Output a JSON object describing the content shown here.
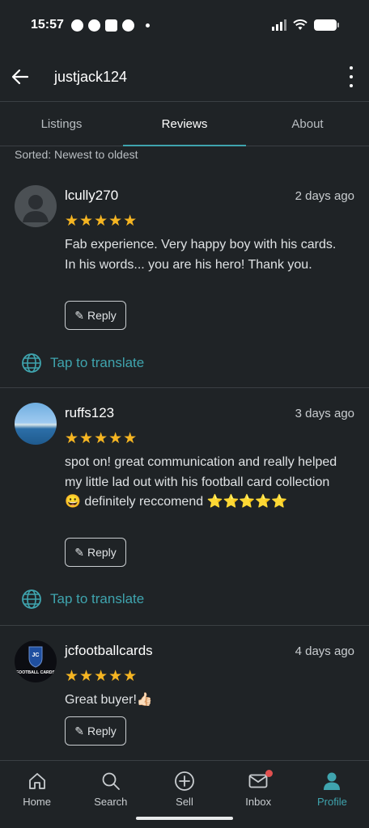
{
  "status_bar": {
    "time": "15:57",
    "app_icons": [
      "chat-icon",
      "whatsapp-icon",
      "twitch-icon",
      "facebook-icon"
    ]
  },
  "header": {
    "title": "justjack124",
    "back_icon": "back-arrow-icon",
    "menu_icon": "more-vertical-icon"
  },
  "tabs": [
    {
      "label": "Listings",
      "active": false
    },
    {
      "label": "Reviews",
      "active": true
    },
    {
      "label": "About",
      "active": false
    }
  ],
  "sorted_label": "Sorted: Newest to oldest",
  "reviews": [
    {
      "username": "lcully270",
      "when": "2 days ago",
      "rating": 5,
      "stars": "★★★★★",
      "text": "Fab experience. Very happy boy with his cards. In his words... you are his hero! Thank you.",
      "reply_label": "Reply",
      "translate_label": "Tap to translate"
    },
    {
      "username": "ruffs123",
      "when": "3 days ago",
      "rating": 5,
      "stars": "★★★★★",
      "text": "spot on! great communication and really helped my little lad out with his football card collection 😀 definitely reccomend ⭐⭐⭐⭐⭐",
      "reply_label": "Reply",
      "translate_label": "Tap to translate"
    },
    {
      "username": "jcfootballcards",
      "when": "4 days ago",
      "rating": 5,
      "stars": "★★★★★",
      "text": "Great buyer!👍🏻",
      "reply_label": "Reply",
      "avatar_text": "FOOTBALL CARDS",
      "avatar_initials": "JC"
    }
  ],
  "bottom_nav": [
    {
      "label": "Home",
      "icon": "home-icon",
      "active": false
    },
    {
      "label": "Search",
      "icon": "search-icon",
      "active": false
    },
    {
      "label": "Sell",
      "icon": "plus-circle-icon",
      "active": false
    },
    {
      "label": "Inbox",
      "icon": "mail-icon",
      "active": false,
      "has_notification": true
    },
    {
      "label": "Profile",
      "icon": "profile-icon",
      "active": true
    }
  ],
  "colors": {
    "background": "#1f2326",
    "accent": "#3fa4ae",
    "star": "#f5b522",
    "notification": "#e0504f"
  }
}
